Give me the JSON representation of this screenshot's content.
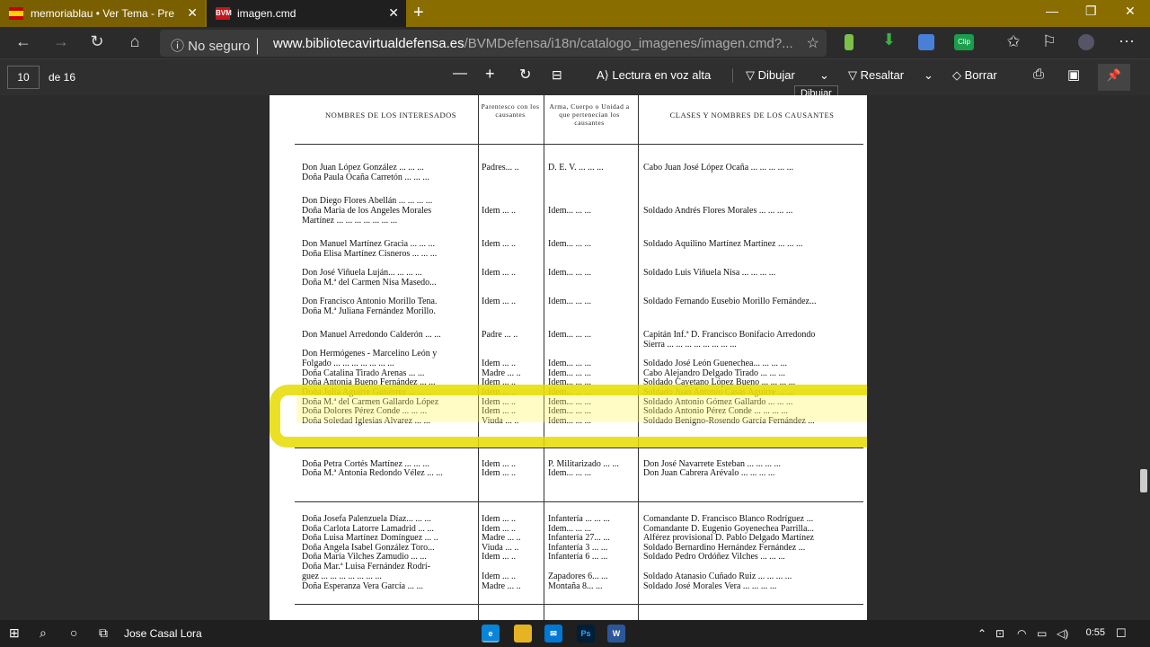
{
  "browser": {
    "tabs": [
      {
        "title": "memoriablau • Ver Tema - Prese",
        "icon": "spain-flag-icon"
      },
      {
        "title": "imagen.cmd",
        "icon": "bvm-icon",
        "icon_text": "BVM"
      }
    ],
    "security_label": "No seguro",
    "url_domain": "www.bibliotecavirtualdefensa.es",
    "url_path": "/BVMDefensa/i18n/catalogo_imagenes/imagen.cmd?...",
    "ext_clip_label": "Clip"
  },
  "pdf_toolbar": {
    "page_current": "10",
    "page_of": "de 16",
    "read_aloud": "Lectura en voz alta",
    "draw": "Dibujar",
    "highlight": "Resaltar",
    "erase": "Borrar",
    "tooltip": "Dibujar"
  },
  "document": {
    "headers": {
      "names": "NOMBRES DE LOS INTERESADOS",
      "kinship": "Parentesco con los causantes",
      "arm": "Arma, Cuerpo o Unidad a que pertenecían los causantes",
      "classes": "CLASES Y NOMBRES DE LOS CAUSANTES"
    },
    "rows": [
      {
        "n": "Don Juan López González ... ... ...",
        "k": "Padres... ..",
        "a": "D. E. V. ... ... ...",
        "c": "Cabo Juan José López Ocaña ... ... ... ... ..."
      },
      {
        "n": "Doña Paula Ocaña Carretón ... ... ...",
        "k": "",
        "a": "",
        "c": ""
      },
      {
        "n": "Don Diego Flores Abellán ... ... ... ...",
        "k": "",
        "a": "",
        "c": ""
      },
      {
        "n": "Doña María de los Angeles Morales",
        "k": "Idem ... ..",
        "a": "Idem... ... ...",
        "c": "Soldado Andrés Flores Morales ... ... ... ..."
      },
      {
        "n": "Martínez ... ... ... ... ... ... ...",
        "k": "",
        "a": "",
        "c": ""
      },
      {
        "n": "Don Manuel Martínez Gracia ... ... ...",
        "k": "Idem ... ..",
        "a": "Idem... ... ...",
        "c": "Soldado Aquilino Martínez Martínez ... ... ..."
      },
      {
        "n": "Doña Elisa Martínez Cisneros ... ... ...",
        "k": "",
        "a": "",
        "c": ""
      },
      {
        "n": "Don José Viñuela Luján... ... ... ...",
        "k": "Idem ... ..",
        "a": "Idem... ... ...",
        "c": "Soldado Luis Viñuela Nisa ... ... ... ..."
      },
      {
        "n": "Doña M.ª del Carmen Nisa Masedo...",
        "k": "",
        "a": "",
        "c": ""
      },
      {
        "n": "Don Francisco Antonio Morillo Tena.",
        "k": "Idem ... ..",
        "a": "Idem... ... ...",
        "c": "Soldado Fernando Eusebio Morillo Fernández..."
      },
      {
        "n": "Doña M.ª Juliana Fernández Morillo.",
        "k": "",
        "a": "",
        "c": ""
      },
      {
        "n": "Don Manuel Arredondo Calderón ... ...",
        "k": "Padre ... ..",
        "a": "Idem... ... ...",
        "c": "Capitán Inf.ª D. Francisco Bonifacio Arredondo"
      },
      {
        "n": "",
        "k": "",
        "a": "",
        "c": "Sierra ... ... ... ... ... ... ... ..."
      },
      {
        "n": "Don Hermógenes - Marcelino León y",
        "k": "",
        "a": "",
        "c": ""
      },
      {
        "n": "Folgado ... ... ... ... ... ... ...",
        "k": "Idem ... ..",
        "a": "Idem... ... ...",
        "c": "Soldado José León Guenechea... ... ... ..."
      },
      {
        "n": "Doña Catalina Tirado Arenas ... ...",
        "k": "Madre ... ..",
        "a": "Idem... ... ...",
        "c": "Cabo Alejandro Delgado Tirado ... ... ..."
      },
      {
        "n": "Doña Antonia Bueno Fernández ... ...",
        "k": "Idem ... ..",
        "a": "Idem... ... ...",
        "c": "Soldado Cayetano López Bueno ... ... ... ..."
      },
      {
        "n": "Doña Julia Aguirre Gutiérrez ... ... ..",
        "k": "Idem ... ..",
        "a": "Idem... ... ...",
        "c": "Soldado Juan Antonio Casas Aguirre ... ..."
      },
      {
        "n": "Doña M.ª del Carmen Gallardo López",
        "k": "Idem ... ..",
        "a": "Idem... ... ...",
        "c": "Soldado Antonio Gómez Gallardo ... ... ..."
      },
      {
        "n": "Doña Dolores Pérez Conde ... ... ...",
        "k": "Idem ... ..",
        "a": "Idem... ... ...",
        "c": "Soldado Antonio Pérez Conde ... ... ... ..."
      },
      {
        "n": "Doña Soledad Iglesias Alvarez ... ...",
        "k": "Viuda ... ..",
        "a": "Idem... ... ...",
        "c": "Soldado Benigno-Rosendo García Fernández ..."
      },
      {
        "n": "Doña Petra Cortés Martínez ... ... ...",
        "k": "Idem ... ..",
        "a": "P. Militarizado ... ...",
        "c": "Don José Navarrete Esteban ... ... ... ..."
      },
      {
        "n": "Doña M.ª Antonia Redondo Vélez ... ...",
        "k": "Idem ... ..",
        "a": "Idem... ... ...",
        "c": "Don Juan Cabrera Arévalo ... ... ... ..."
      },
      {
        "n": "Doña Josefa Palenzuela Díaz... ... ...",
        "k": "Idem ... ..",
        "a": "Infantería ... ... ...",
        "c": "Comandante D. Francisco Blanco Rodríguez ..."
      },
      {
        "n": "Doña Carlota Latorre Lamadrid ... ...",
        "k": "Idem ... ..",
        "a": "Idem... ... ...",
        "c": "Comandante D. Eugenio Goyenechea Parrilla..."
      },
      {
        "n": "Doña Luisa Martínez Domínguez ... ..",
        "k": "Madre ... ..",
        "a": "Infantería 27... ...",
        "c": "Alférez provisional D. Pablo Delgado Martínez"
      },
      {
        "n": "Doña Angela Isabel González Toro...",
        "k": "Viuda ... ..",
        "a": "Infantería 3 ... ...",
        "c": "Soldado Bernardino Hernández Fernández ..."
      },
      {
        "n": "Doña María Vilches Zamudio ... ...",
        "k": "Idem ... ..",
        "a": "Infantería 6 ... ...",
        "c": "Soldado Pedro Ordóñez Vilches ... ... ..."
      },
      {
        "n": "Doña Mar.ª Luisa Fernández Rodrí-",
        "k": "",
        "a": "",
        "c": ""
      },
      {
        "n": "guez ... ... ... ... ... ... ...",
        "k": "Idem ... ..",
        "a": "Zapadores 6... ...",
        "c": "Soldado Atanasio Cuñado Ruiz ... ... ... ..."
      },
      {
        "n": "Doña Esperanza Vera García ... ...",
        "k": "Madre ... ..",
        "a": "Montaña 8... ...",
        "c": "Soldado José Morales Vera ... ... ... ..."
      }
    ]
  },
  "taskbar": {
    "user": "Jose Casal Lora",
    "time": "0:55",
    "apps": [
      "edge-icon",
      "explorer-icon",
      "mail-icon",
      "photoshop-icon",
      "word-icon"
    ]
  }
}
